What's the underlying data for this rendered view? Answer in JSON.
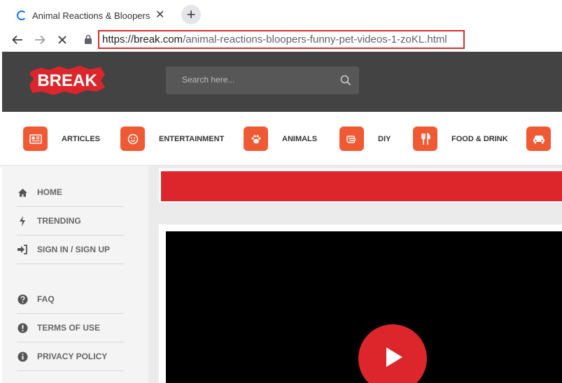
{
  "browser": {
    "tab_title": "Animal Reactions & Bloopers - ",
    "url_host": "https://break.com",
    "url_path": "/animal-reactions-bloopers-funny-pet-videos-1-zoKL.html"
  },
  "header": {
    "logo_text": "BREAK",
    "search_placeholder": "Search here..."
  },
  "categories": [
    {
      "label": "ARTICLES",
      "icon": "newspaper-icon"
    },
    {
      "label": "ENTERTAINMENT",
      "icon": "smiley-icon"
    },
    {
      "label": "ANIMALS",
      "icon": "paw-icon"
    },
    {
      "label": "DIY",
      "icon": "hand-icon"
    },
    {
      "label": "FOOD & DRINK",
      "icon": "fork-knife-icon"
    },
    {
      "label": "",
      "icon": "car-icon"
    }
  ],
  "sidebar": {
    "items": [
      {
        "label": "HOME",
        "icon": "home-icon"
      },
      {
        "label": "TRENDING",
        "icon": "bolt-icon"
      },
      {
        "label": "SIGN IN / SIGN UP",
        "icon": "sign-in-icon"
      },
      {
        "label": "FAQ",
        "icon": "question-circle-icon"
      },
      {
        "label": "TERMS OF USE",
        "icon": "exclamation-circle-icon"
      },
      {
        "label": "PRIVACY POLICY",
        "icon": "info-circle-icon"
      }
    ]
  },
  "colors": {
    "accent": "#ef5a35",
    "brand_red": "#dc262c",
    "header_bg": "#434343"
  }
}
